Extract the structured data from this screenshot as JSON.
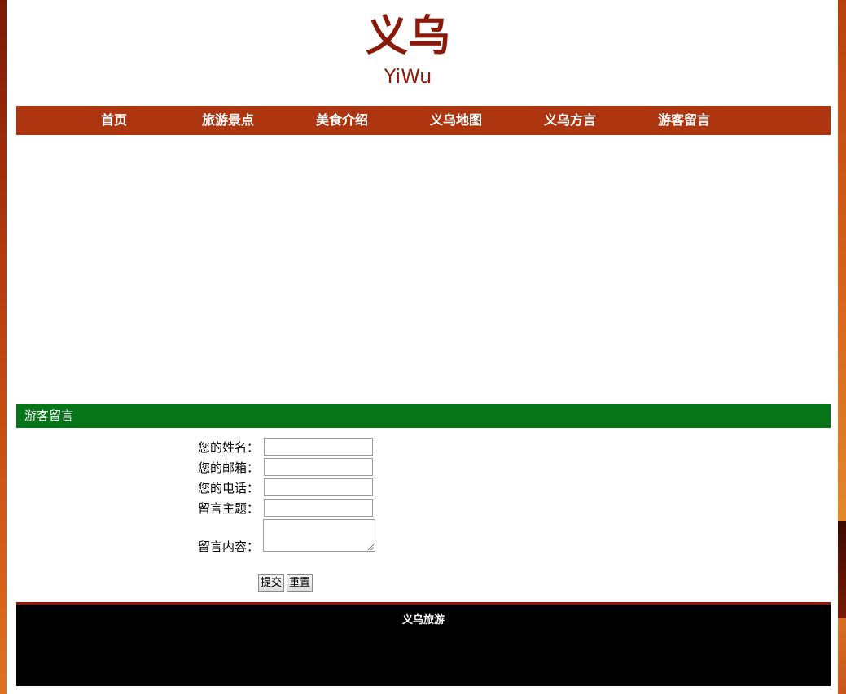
{
  "header": {
    "title": "义乌",
    "subtitle": "YiWu"
  },
  "nav": {
    "items": [
      {
        "label": "首页"
      },
      {
        "label": "旅游景点"
      },
      {
        "label": "美食介绍"
      },
      {
        "label": "义乌地图"
      },
      {
        "label": "义乌方言"
      },
      {
        "label": "游客留言"
      }
    ]
  },
  "section": {
    "title": "游客留言"
  },
  "form": {
    "name_label": "您的姓名：",
    "name_value": "",
    "email_label": "您的邮箱：",
    "email_value": "",
    "phone_label": "您的电话：",
    "phone_value": "",
    "subject_label": "留言主题：",
    "subject_value": "",
    "content_label": "留言内容：",
    "content_value": "",
    "submit_label": "提交",
    "reset_label": "重置"
  },
  "footer": {
    "text": "义乌旅游"
  },
  "colors": {
    "nav_bg": "#ad3510",
    "section_bg": "#06751a",
    "title_color": "#8b1a0a",
    "footer_bg": "#000000"
  }
}
